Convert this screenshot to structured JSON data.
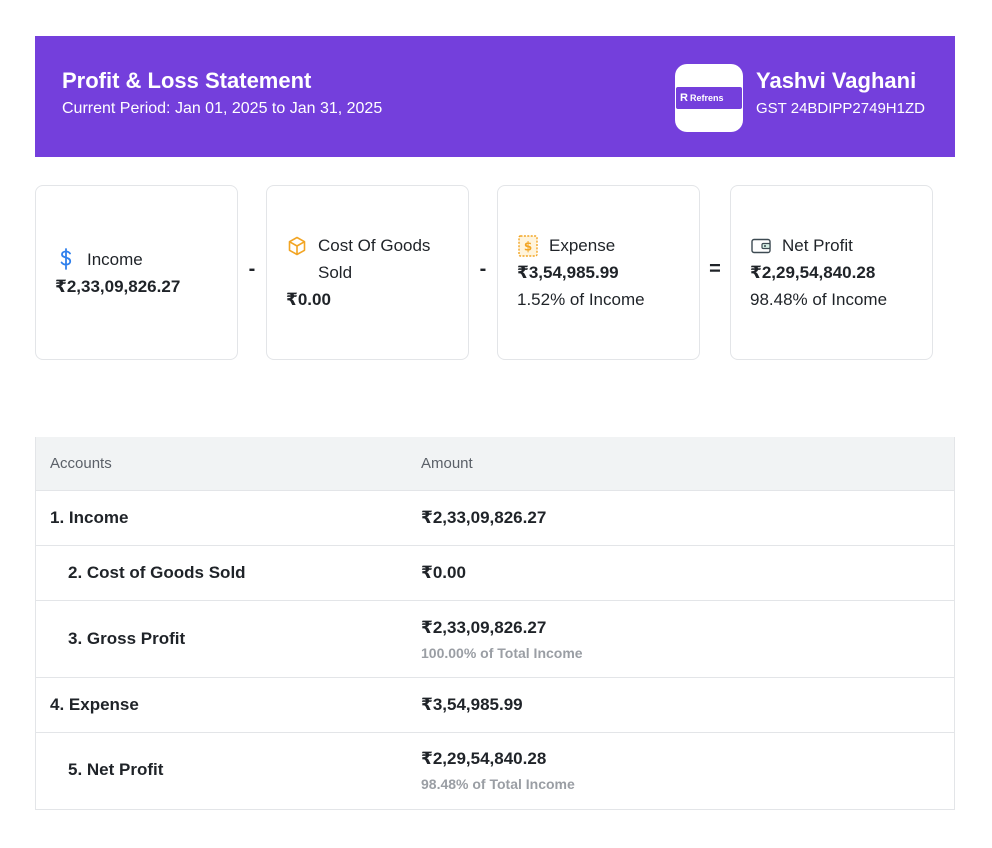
{
  "header": {
    "title": "Profit & Loss Statement",
    "period": "Current Period: Jan 01, 2025 to Jan 31, 2025",
    "logo_text": "Refrens",
    "logo_mark": "R",
    "business_name": "Yashvi Vaghani",
    "gst": "GST 24BDIPP2749H1ZD",
    "colors": {
      "header_bg": "#743fdc"
    }
  },
  "cards": [
    {
      "label": "Income",
      "value": "₹2,33,09,826.27",
      "icon": "dollar-icon"
    },
    {
      "label": "Cost Of Goods Sold",
      "value": "₹0.00",
      "icon": "box-icon"
    },
    {
      "label": "Expense",
      "value": "₹3,54,985.99",
      "pct": "1.52% of Income",
      "icon": "receipt-icon"
    },
    {
      "label": "Net Profit",
      "value": "₹2,29,54,840.28",
      "pct": "98.48% of Income",
      "icon": "wallet-icon"
    }
  ],
  "operators": [
    "-",
    "-",
    "="
  ],
  "table": {
    "headers": {
      "accounts": "Accounts",
      "amount": "Amount"
    },
    "rows": [
      {
        "account": "1. Income",
        "amount": "₹2,33,09,826.27"
      },
      {
        "account": "2. Cost of Goods Sold",
        "amount": "₹0.00"
      },
      {
        "account": "3. Gross Profit",
        "amount": "₹2,33,09,826.27",
        "sub": "100.00% of Total Income"
      },
      {
        "account": "4. Expense",
        "amount": "₹3,54,985.99"
      },
      {
        "account": "5. Net Profit",
        "amount": "₹2,29,54,840.28",
        "sub": "98.48% of Total Income"
      }
    ]
  }
}
